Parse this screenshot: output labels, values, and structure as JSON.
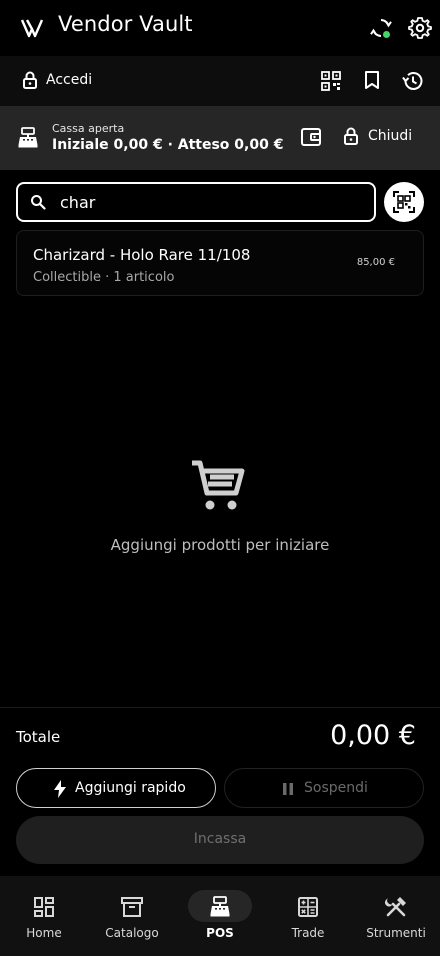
{
  "app": {
    "title": "Vendor Vault"
  },
  "colors": {
    "background": "#000000",
    "accent": "#ffffff",
    "sync_status": "#4cd06a",
    "panel": "#262626"
  },
  "login_bar": {
    "login_label": "Accedi"
  },
  "register": {
    "status": "Cassa aperta",
    "totals": "Iniziale 0,00 € · Atteso 0,00 €",
    "close_label": "Chiudi"
  },
  "search": {
    "value": "char"
  },
  "results": [
    {
      "name": "Charizard - Holo Rare 11/108",
      "subtitle": "Collectible · 1 articolo",
      "price": "85,00 €"
    }
  ],
  "cart": {
    "empty_message": "Aggiungi prodotti per iniziare"
  },
  "totals": {
    "label": "Totale",
    "value": "0,00 €"
  },
  "actions": {
    "quick_add": "Aggiungi rapido",
    "suspend": "Sospendi",
    "checkout": "Incassa"
  },
  "nav": {
    "active": "POS",
    "items": [
      {
        "label": "Home",
        "icon": "dashboard-icon"
      },
      {
        "label": "Catalogo",
        "icon": "archive-icon"
      },
      {
        "label": "POS",
        "icon": "cash-register-icon"
      },
      {
        "label": "Trade",
        "icon": "calculator-icon"
      },
      {
        "label": "Strumenti",
        "icon": "tools-icon"
      }
    ]
  }
}
